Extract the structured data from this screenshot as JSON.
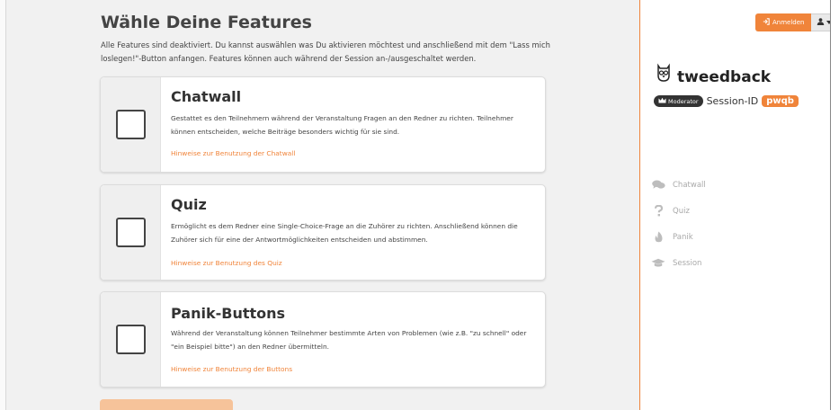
{
  "main": {
    "title": "Wähle Deine Features",
    "description": "Alle Features sind deaktiviert. Du kannst auswählen was Du aktivieren möchtest und anschließend mit dem \"Lass mich loslegen!\"-Button anfangen. Features können auch während der Session an-/ausgeschaltet werden.",
    "cards": [
      {
        "title": "Chatwall",
        "text": "Gestattet es den Teilnehmern während der Veranstaltung Fragen an den Redner zu richten. Teilnehmer können entscheiden, welche Beiträge besonders wichtig für sie sind.",
        "link": "Hinweise zur Benutzung der Chatwall",
        "checked": false
      },
      {
        "title": "Quiz",
        "text": "Ermöglicht es dem Redner eine Single-Choice-Frage an die Zuhörer zu richten. Anschließend können die Zuhörer sich für eine der Antwortmöglichkeiten entscheiden und abstimmen.",
        "link": "Hinweise zur Benutzung des Quiz",
        "checked": false
      },
      {
        "title": "Panik-Buttons",
        "text": "Während der Veranstaltung können Teilnehmer bestimmte Arten von Problemen (wie z.B. \"zu schnell\" oder \"ein Beispiel bitte\") an den Redner übermitteln.",
        "link": "Hinweise zur Benutzung der Buttons",
        "checked": false
      }
    ]
  },
  "sidebar": {
    "login_label": "Anmelden",
    "login_icon": "sign-in-icon",
    "user_icon": "user-icon",
    "brand_name": "tweedback",
    "moderator_label": "Moderator",
    "session_label": "Session-ID",
    "session_id": "pwqb",
    "nav": [
      {
        "label": "Chatwall",
        "icon": "comments-icon"
      },
      {
        "label": "Quiz",
        "icon": "question-icon"
      },
      {
        "label": "Panik",
        "icon": "fire-icon"
      },
      {
        "label": "Session",
        "icon": "graduation-cap-icon"
      }
    ]
  },
  "colors": {
    "accent": "#f0843a",
    "nav_text": "#a9a9a9",
    "sidebar_border": "#f0843a"
  }
}
